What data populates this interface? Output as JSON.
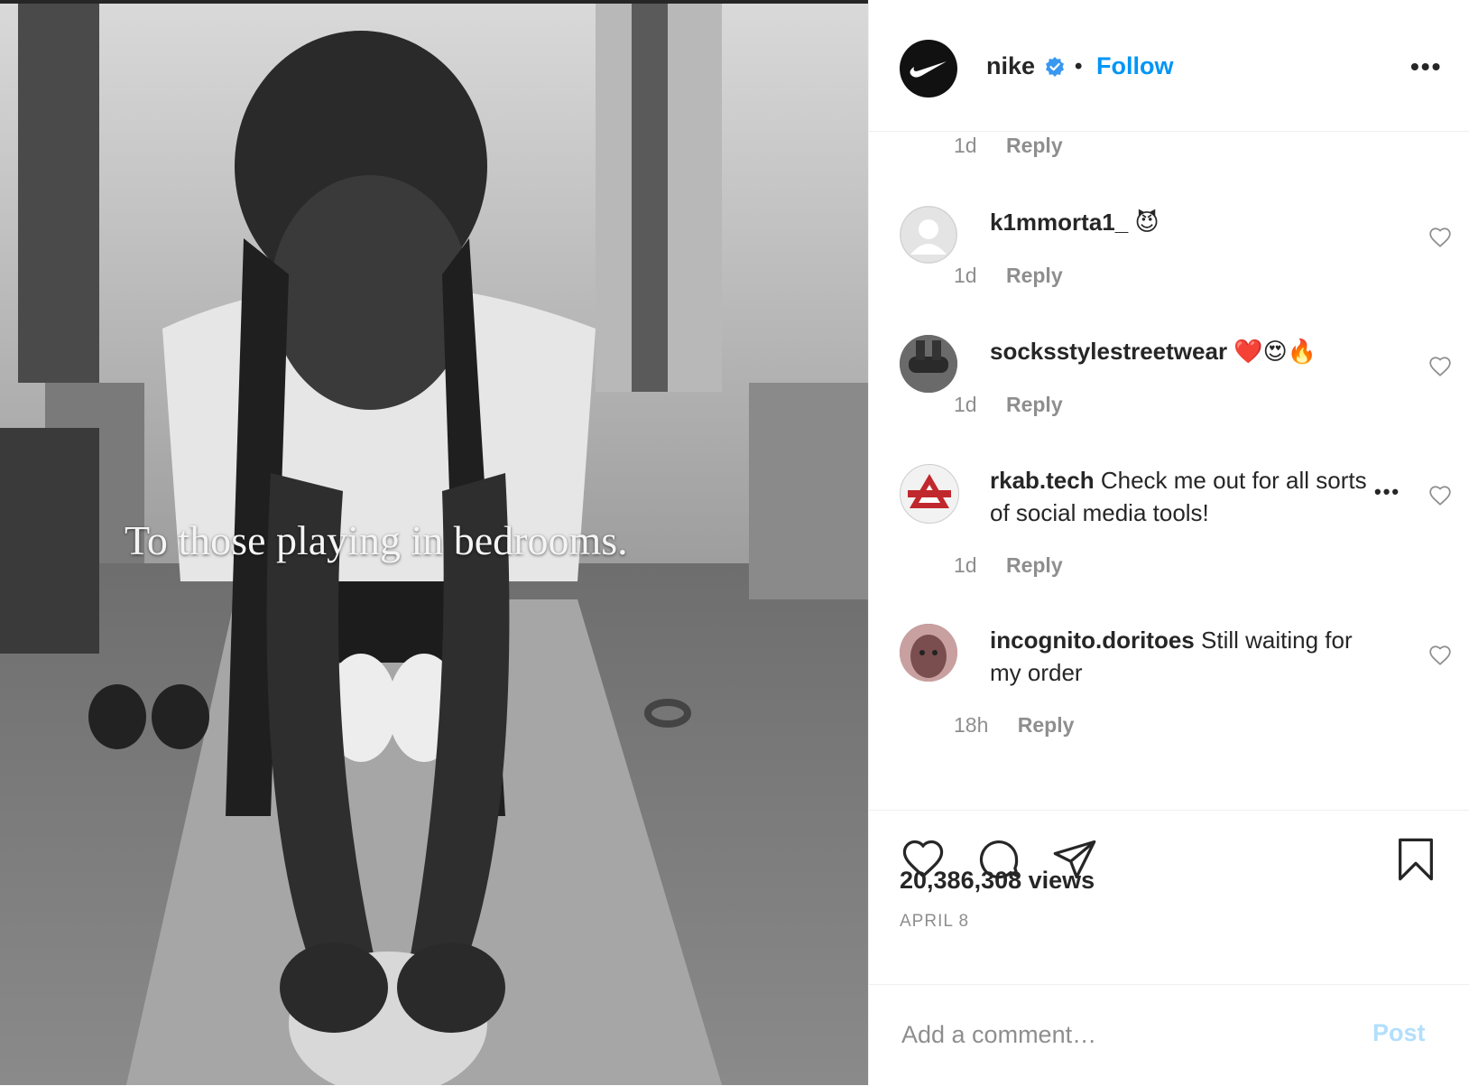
{
  "post": {
    "overlay_text": "To those playing in bedrooms.",
    "author": "nike",
    "follow_label": "Follow",
    "separator": "•",
    "more_label": "•••",
    "views": "20,386,308 views",
    "date": "APRIL 8"
  },
  "comments": [
    {
      "username": "",
      "text": "",
      "time": "1d",
      "reply": "Reply"
    },
    {
      "username": "k1mmorta1_",
      "text": "😈",
      "time": "1d",
      "reply": "Reply"
    },
    {
      "username": "socksstylestreetwear",
      "text": "❤️😍🔥",
      "time": "1d",
      "reply": "Reply"
    },
    {
      "username": "rkab.tech",
      "text": "Check me out for all sorts of social media tools!",
      "time": "1d",
      "reply": "Reply",
      "more": "•••"
    },
    {
      "username": "incognito.doritoes",
      "text": "Still waiting for my order",
      "time": "18h",
      "reply": "Reply"
    }
  ],
  "composer": {
    "placeholder": "Add a comment…",
    "post_label": "Post"
  },
  "colors": {
    "link_blue": "#0095f6",
    "post_disabled": "#b2dffc",
    "secondary_text": "#8e8e8e"
  }
}
